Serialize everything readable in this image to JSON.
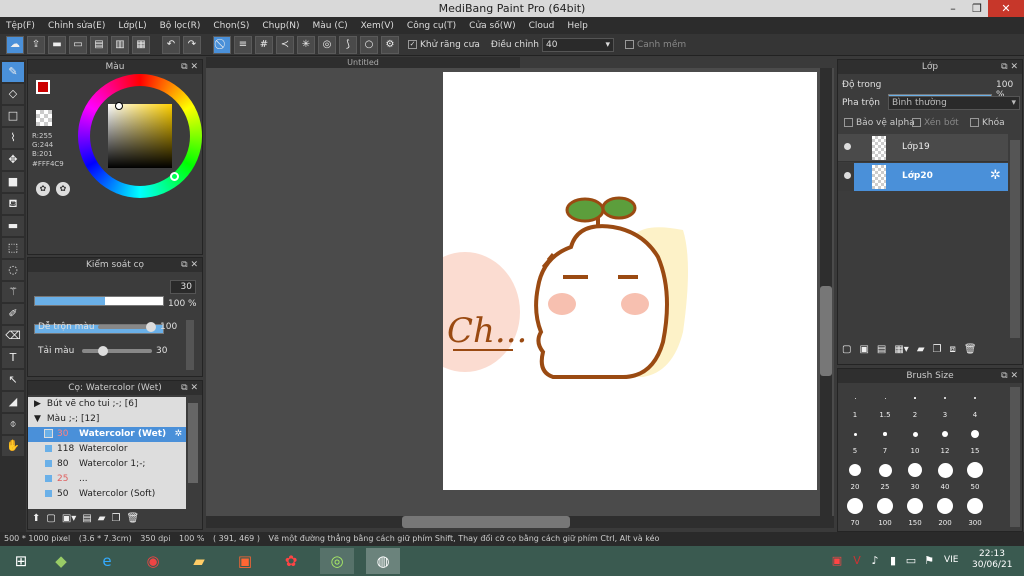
{
  "window": {
    "title": "MediBang Paint Pro (64bit)",
    "min": "–",
    "max": "❐",
    "close": "✕"
  },
  "menu": [
    "Tệp(F)",
    "Chỉnh sửa(E)",
    "Lớp(L)",
    "Bộ lọc(R)",
    "Chọn(S)",
    "Chụp(N)",
    "Màu (C)",
    "Xem(V)",
    "Công cụ(T)",
    "Cửa số(W)",
    "Cloud",
    "Help"
  ],
  "toolbar": {
    "antialias": "Khử răng cưa",
    "adjust_label": "Điều chỉnh",
    "adjust_value": "40",
    "snap": "Canh mềm"
  },
  "canvas_tab": "Untitled",
  "color_panel": {
    "title": "Màu",
    "r": "R:255",
    "g": "G:244",
    "b": "B:201",
    "hex": "#FFF4C9",
    "primary": "#cc0000",
    "secondary": "#8ab4e8"
  },
  "brush_control": {
    "title": "Kiểm soát cọ",
    "size": "30",
    "opacity": "100 %",
    "blend_label": "Dễ trộn màu",
    "blend_value": "100",
    "amount_label": "Tải màu",
    "amount_value": "30"
  },
  "brush_panel": {
    "title": "Cọ: Watercolor (Wet)",
    "groups": [
      "Bút vẽ cho tui ;-; [6]",
      "Màu ;-; [12]"
    ],
    "items": [
      {
        "size": "30",
        "name": "Watercolor (Wet)",
        "selected": true
      },
      {
        "size": "118",
        "name": "Watercolor"
      },
      {
        "size": "80",
        "name": "Watercolor 1;-;"
      },
      {
        "size": "25",
        "name": "..."
      },
      {
        "size": "50",
        "name": "Watercolor (Soft)"
      }
    ]
  },
  "layer_panel": {
    "title": "Lớp",
    "opacity_label": "Độ trong",
    "opacity_value": "100 %",
    "blend_label": "Pha trộn",
    "blend_value": "Bình thường",
    "protect_alpha": "Bảo vệ alpha",
    "clip": "Xén bớt",
    "lock": "Khóa",
    "layers": [
      {
        "name": "Lớp19",
        "selected": false
      },
      {
        "name": "Lớp20",
        "selected": true
      }
    ]
  },
  "brush_size": {
    "title": "Brush Size",
    "sizes": [
      "1",
      "1.5",
      "2",
      "3",
      "4",
      "5",
      "7",
      "10",
      "12",
      "15",
      "20",
      "25",
      "30",
      "40",
      "50",
      "70",
      "100",
      "150",
      "200",
      "300"
    ]
  },
  "status": {
    "dims": "500 * 1000 pixel",
    "cm": "(3.6 * 7.3cm)",
    "dpi": "350 dpi",
    "zoom": "100 %",
    "coords": "( 391, 469 )",
    "hint": "Vẽ một đường thẳng bằng cách giữ phím Shift, Thay đổi cỡ cọ bằng cách giữ phím Ctrl, Alt và kéo"
  },
  "taskbar": {
    "lang": "VIE",
    "time": "22:13",
    "date": "30/06/21"
  },
  "drawing": {
    "text": "Ch..."
  }
}
